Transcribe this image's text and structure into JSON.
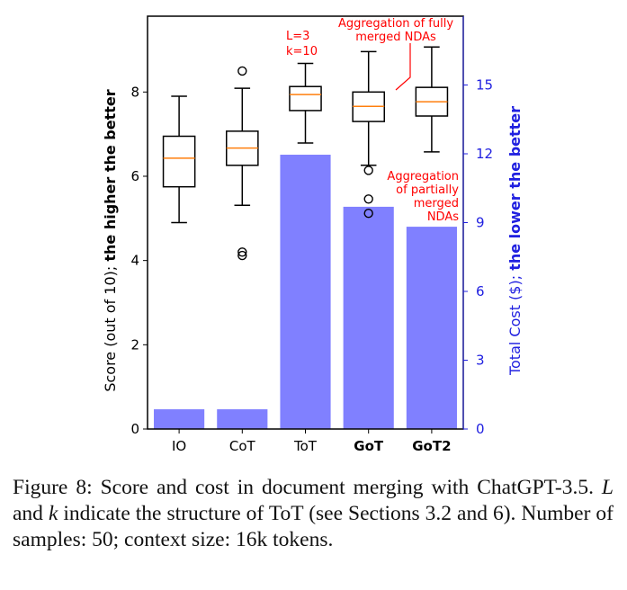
{
  "chart_data": {
    "type": "box+bar",
    "categories": [
      "IO",
      "CoT",
      "ToT",
      "GoT",
      "GoT2"
    ],
    "bold_categories": [
      "GoT",
      "GoT2"
    ],
    "left_axis": {
      "label_plain": "Score (out of 10); ",
      "label_bold": "the higher the better",
      "ylim": [
        0,
        9.8
      ],
      "ticks": [
        0,
        2,
        4,
        6,
        8
      ],
      "color": "#000000"
    },
    "right_axis": {
      "label_plain": "Total Cost ($); ",
      "label_bold": "the lower the better",
      "ylim": [
        0,
        18.0
      ],
      "ticks": [
        0,
        3,
        6,
        9,
        12,
        15
      ],
      "color": "#2020e0"
    },
    "score_boxes": [
      {
        "name": "IO",
        "whisker_low": 4.9,
        "q1": 5.75,
        "median": 6.43,
        "q3": 6.95,
        "whisker_high": 7.9,
        "fliers": []
      },
      {
        "name": "CoT",
        "whisker_low": 5.31,
        "q1": 6.26,
        "median": 6.67,
        "q3": 7.07,
        "whisker_high": 8.09,
        "fliers": [
          8.5,
          4.2,
          4.12
        ]
      },
      {
        "name": "ToT",
        "whisker_low": 6.79,
        "q1": 7.56,
        "median": 7.94,
        "q3": 8.13,
        "whisker_high": 8.68,
        "fliers": []
      },
      {
        "name": "GoT",
        "whisker_low": 6.26,
        "q1": 7.3,
        "median": 7.66,
        "q3": 8.0,
        "whisker_high": 8.96,
        "fliers": [
          6.14,
          5.46,
          5.12
        ]
      },
      {
        "name": "GoT2",
        "whisker_low": 6.58,
        "q1": 7.43,
        "median": 7.77,
        "q3": 8.11,
        "whisker_high": 9.07,
        "fliers": []
      }
    ],
    "cost_bars": {
      "name": "Total Cost ($)",
      "values": [
        0.86,
        0.86,
        11.96,
        9.69,
        8.82
      ],
      "color": "#8080ff"
    },
    "median_color": "#ff7f0e",
    "annotations": [
      {
        "lines": [
          "L=3",
          "k=10"
        ],
        "target": "ToT"
      },
      {
        "lines": [
          "Aggregation of fully",
          "merged NDAs"
        ],
        "target": "GoT"
      },
      {
        "lines": [
          "Aggregation",
          "of partially",
          "merged",
          "NDAs"
        ],
        "target": "GoT"
      }
    ],
    "grid": false,
    "legend": "none"
  },
  "caption": {
    "prefix": "Figure 8: Score and cost in document merging with ChatGPT-3.5. ",
    "var_L": "L",
    "and": " and ",
    "var_k": "k",
    "suffix": " indicate the structure of ToT (see Sections 3.2 and 6). Number of samples: 50; context size: 16k tokens."
  }
}
